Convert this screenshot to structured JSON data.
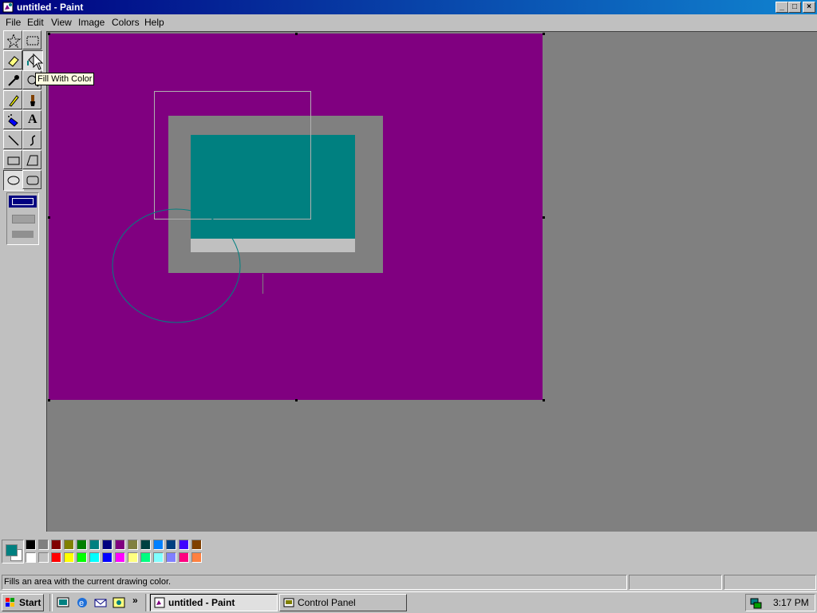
{
  "window": {
    "title": "untitled - Paint",
    "controls": {
      "minimize": "_",
      "maximize": "□",
      "close": "×"
    }
  },
  "menu": [
    "File",
    "Edit",
    "View",
    "Image",
    "Colors",
    "Help"
  ],
  "toolbox": {
    "tools": [
      {
        "name": "free-form-select",
        "icon": "star-select-icon"
      },
      {
        "name": "select",
        "icon": "rect-select-icon"
      },
      {
        "name": "eraser",
        "icon": "eraser-icon"
      },
      {
        "name": "fill-with-color",
        "icon": "paint-bucket-icon",
        "active": true
      },
      {
        "name": "pick-color",
        "icon": "eyedropper-icon"
      },
      {
        "name": "magnifier",
        "icon": "magnifier-icon"
      },
      {
        "name": "pencil",
        "icon": "pencil-icon"
      },
      {
        "name": "brush",
        "icon": "brush-icon"
      },
      {
        "name": "airbrush",
        "icon": "airbrush-icon"
      },
      {
        "name": "text",
        "icon": "text-A-icon"
      },
      {
        "name": "line",
        "icon": "line-icon"
      },
      {
        "name": "curve",
        "icon": "curve-icon"
      },
      {
        "name": "rectangle",
        "icon": "rectangle-icon"
      },
      {
        "name": "polygon",
        "icon": "polygon-icon"
      },
      {
        "name": "ellipse",
        "icon": "ellipse-icon",
        "active": true
      },
      {
        "name": "rounded-rectangle",
        "icon": "rounded-rect-icon"
      }
    ],
    "text_glyph": "A"
  },
  "tooltip": "Fill With Color",
  "colors": {
    "canvas_bg": "#800080",
    "foreground": "#008080",
    "background": "#ffffff",
    "palette_row1": [
      "#000000",
      "#808080",
      "#800000",
      "#808000",
      "#008000",
      "#008080",
      "#000080",
      "#800080",
      "#808040",
      "#004040",
      "#0080ff",
      "#004080",
      "#4000ff",
      "#804000"
    ],
    "palette_row2": [
      "#ffffff",
      "#c0c0c0",
      "#ff0000",
      "#ffff00",
      "#00ff00",
      "#00ffff",
      "#0000ff",
      "#ff00ff",
      "#ffff80",
      "#00ff80",
      "#80ffff",
      "#8080ff",
      "#ff0080",
      "#ff8040"
    ]
  },
  "status": {
    "text": "Fills an area with the current drawing color."
  },
  "taskbar": {
    "start_label": "Start",
    "tasks": [
      {
        "label": "untitled - Paint",
        "active": true
      },
      {
        "label": "Control Panel",
        "active": false
      }
    ],
    "chevron": "»",
    "clock": "3:17 PM"
  }
}
